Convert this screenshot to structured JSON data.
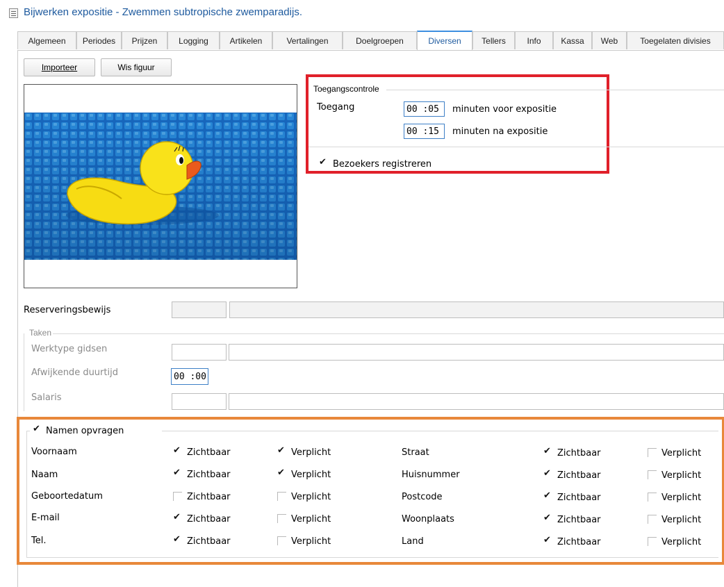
{
  "window": {
    "title": "Bijwerken expositie - Zwemmen subtropische zwemparadijs."
  },
  "tabs": [
    {
      "label": "Algemeen"
    },
    {
      "label": "Periodes"
    },
    {
      "label": "Prijzen"
    },
    {
      "label": "Logging"
    },
    {
      "label": "Artikelen"
    },
    {
      "label": "Vertalingen"
    },
    {
      "label": "Doelgroepen"
    },
    {
      "label": "Diversen"
    },
    {
      "label": "Tellers"
    },
    {
      "label": "Info"
    },
    {
      "label": "Kassa"
    },
    {
      "label": "Web"
    },
    {
      "label": "Toegelaten divisies"
    }
  ],
  "active_tab": "Diversen",
  "toolbar": {
    "import_label": "Importeer",
    "clear_label": "Wis figuur"
  },
  "access": {
    "group_title": "Toegangscontrole",
    "label": "Toegang",
    "before_value": "00 :05",
    "before_unit": "minuten voor expositie",
    "after_value": "00 :15",
    "after_unit": "minuten na expositie",
    "register_label": "Bezoekers registreren",
    "register_checked": true
  },
  "reservation": {
    "label": "Reserveringsbewijs"
  },
  "tasks": {
    "group_title": "Taken",
    "worktype_label": "Werktype gidsen",
    "duration_label": "Afwijkende duurtijd",
    "duration_value": "00 :00",
    "salary_label": "Salaris"
  },
  "names": {
    "group_label": "Namen opvragen",
    "group_checked": true,
    "visible_label": "Zichtbaar",
    "required_label": "Verplicht",
    "left": [
      {
        "label": "Voornaam",
        "visible": true,
        "required": true
      },
      {
        "label": "Naam",
        "visible": true,
        "required": true
      },
      {
        "label": "Geboortedatum",
        "visible": false,
        "required": false
      },
      {
        "label": "E-mail",
        "visible": true,
        "required": false
      },
      {
        "label": "Tel.",
        "visible": true,
        "required": false
      }
    ],
    "right": [
      {
        "label": "Straat",
        "visible": true,
        "required": false
      },
      {
        "label": "Huisnummer",
        "visible": true,
        "required": false
      },
      {
        "label": "Postcode",
        "visible": true,
        "required": false
      },
      {
        "label": "Woonplaats",
        "visible": true,
        "required": false
      },
      {
        "label": "Land",
        "visible": true,
        "required": false
      }
    ]
  },
  "colors": {
    "title": "#1e5a9e",
    "active_tab_accent": "#3d8fe0",
    "highlight_red": "#e0202a",
    "highlight_orange": "#e8883a"
  }
}
